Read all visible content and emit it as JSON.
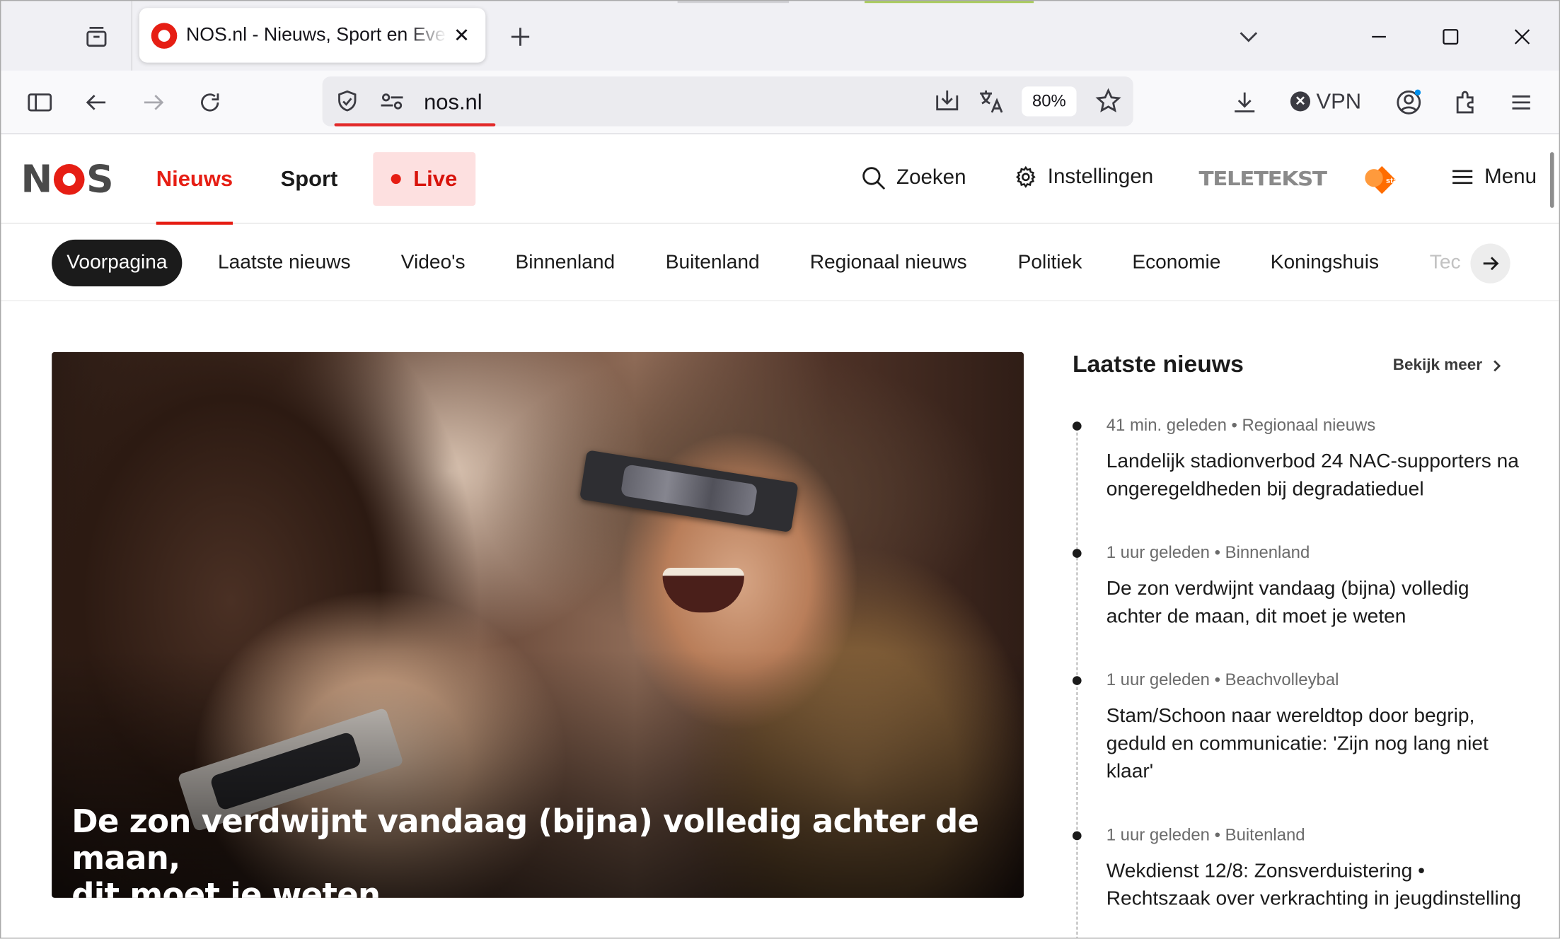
{
  "browser": {
    "tab": {
      "title": "NOS.nl - Nieuws, Sport en Evenementen"
    },
    "url": "nos.nl",
    "zoom": "80%",
    "vpn_label": "VPN"
  },
  "site": {
    "logo": {
      "n": "N",
      "s": "S"
    },
    "nav": {
      "nieuws": "Nieuws",
      "sport": "Sport",
      "live": "Live"
    },
    "search": "Zoeken",
    "settings": "Instellingen",
    "teletekst": "TELETEKST",
    "menu": "Menu",
    "categories": [
      "Voorpagina",
      "Laatste nieuws",
      "Video's",
      "Binnenland",
      "Buitenland",
      "Regionaal nieuws",
      "Politiek",
      "Economie",
      "Koningshuis",
      "Tec"
    ]
  },
  "hero": {
    "caption_line1": "De zon verdwijnt vandaag (bijna) volledig achter de maan,",
    "caption_line2": "dit moet je weten"
  },
  "latest": {
    "title": "Laatste nieuws",
    "more": "Bekijk meer",
    "items": [
      {
        "meta": "41 min. geleden • Regionaal nieuws",
        "headline": "Landelijk stadionverbod 24 NAC-supporters na ongeregeldheden bij degradatieduel"
      },
      {
        "meta": "1 uur geleden • Binnenland",
        "headline": "De zon verdwijnt vandaag (bijna) volledig achter de maan, dit moet je weten"
      },
      {
        "meta": "1 uur geleden • Beachvolleybal",
        "headline": "Stam/Schoon naar wereldtop door begrip, geduld en communicatie: 'Zijn nog lang niet klaar'"
      },
      {
        "meta": "1 uur geleden • Buitenland",
        "headline": "Wekdienst 12/8: Zonsverduistering • Rechtszaak over verkrachting in jeugdinstelling"
      }
    ]
  },
  "colors": {
    "brand_red": "#e61e14",
    "live_bg": "#fde0e0",
    "url_underline": "#e22b2b"
  },
  "icons": [
    "tab-groups-icon",
    "close-icon",
    "plus-icon",
    "chevron-down-icon",
    "minimize-icon",
    "maximize-icon",
    "sidebar-icon",
    "back-icon",
    "forward-icon",
    "reload-icon",
    "shield-icon",
    "site-info-icon",
    "save-page-icon",
    "translate-icon",
    "star-icon",
    "download-icon",
    "account-icon",
    "extensions-icon",
    "hamburger-icon",
    "search-icon",
    "gear-icon",
    "arrow-right-icon",
    "chevron-right-icon"
  ]
}
